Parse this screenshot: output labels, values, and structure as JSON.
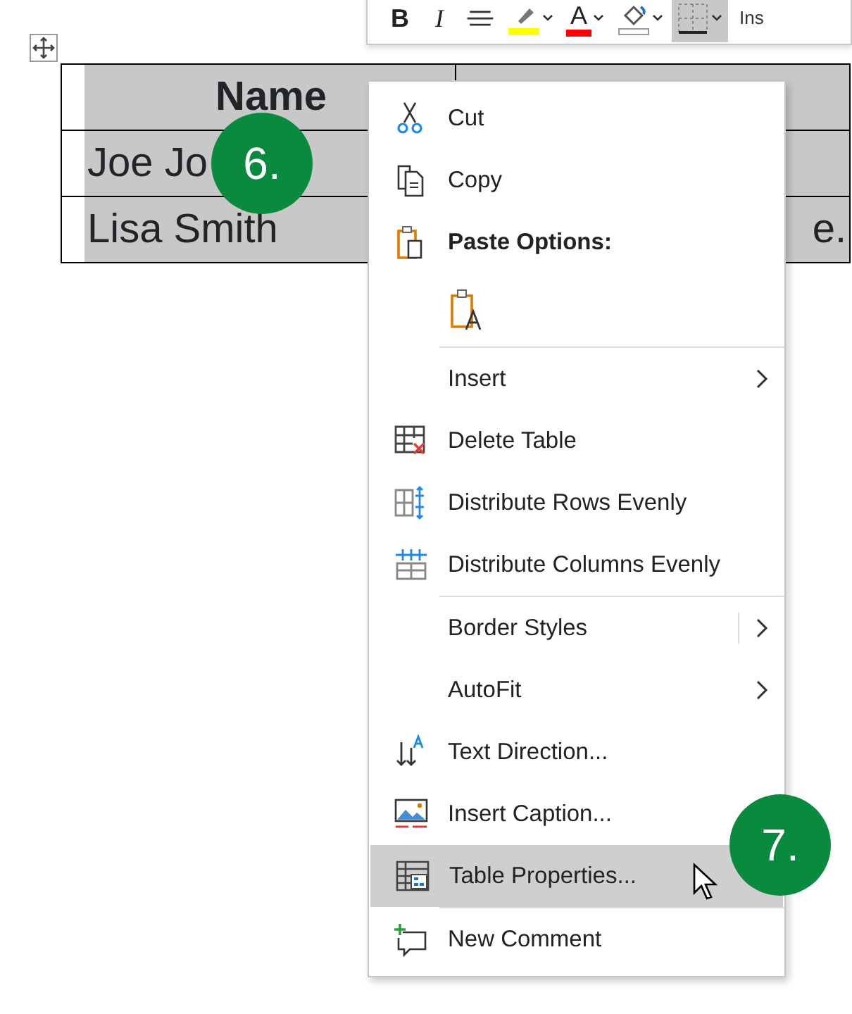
{
  "toolbar": {
    "buttons": [
      {
        "label": "B",
        "kind": "bold",
        "selected": false
      },
      {
        "label": "I",
        "kind": "italic",
        "selected": false
      },
      {
        "kind": "align",
        "selected": false
      },
      {
        "kind": "highlight",
        "color": "#ffff00",
        "selected": false
      },
      {
        "kind": "fontcolor",
        "label": "A",
        "color": "#ff0000",
        "selected": false
      },
      {
        "kind": "shading",
        "color": "#ffffff",
        "selected": false
      },
      {
        "kind": "borders",
        "selected": true
      }
    ],
    "cut_text": "Ins"
  },
  "table": {
    "header": [
      "Name"
    ],
    "rows": [
      {
        "column_1": "Joe Jo"
      },
      {
        "column_1": "Lisa Smith",
        "column_2": "e."
      }
    ]
  },
  "menu": {
    "items": [
      {
        "kind": "command",
        "label": "Cut",
        "highlighted": false
      },
      {
        "kind": "command",
        "label": "Copy",
        "highlighted": false
      },
      {
        "kind": "header",
        "label": "Paste Options:"
      },
      {
        "kind": "paste_icons"
      },
      {
        "kind": "separator"
      },
      {
        "kind": "submenu",
        "label": "Insert",
        "highlighted": false,
        "split": false
      },
      {
        "kind": "command",
        "label": "Delete Table",
        "highlighted": false
      },
      {
        "kind": "command",
        "label": "Distribute Rows Evenly",
        "highlighted": false
      },
      {
        "kind": "command",
        "label": "Distribute Columns Evenly",
        "highlighted": false
      },
      {
        "kind": "separator"
      },
      {
        "kind": "submenu",
        "label": "Border Styles",
        "highlighted": false,
        "split": true
      },
      {
        "kind": "submenu",
        "label": "AutoFit",
        "highlighted": false,
        "split": false
      },
      {
        "kind": "command",
        "label": "Text Direction...",
        "highlighted": false
      },
      {
        "kind": "command",
        "label": "Insert Caption...",
        "highlighted": false
      },
      {
        "kind": "command",
        "label": "Table Properties...",
        "highlighted": true
      },
      {
        "kind": "separator"
      },
      {
        "kind": "command",
        "label": "New Comment",
        "highlighted": false
      }
    ]
  },
  "callouts": [
    {
      "label": "6."
    },
    {
      "label": "7."
    }
  ]
}
